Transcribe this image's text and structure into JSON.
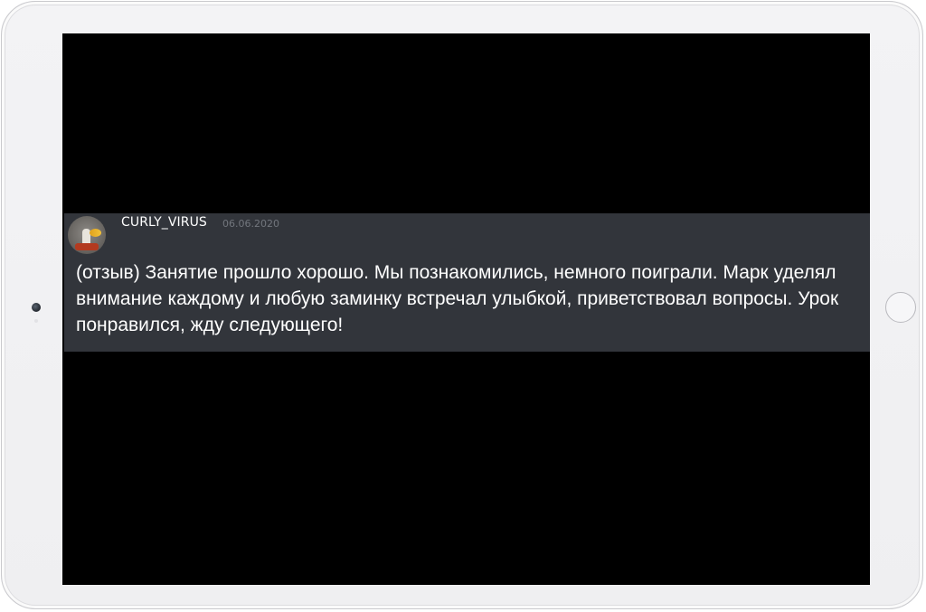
{
  "message": {
    "author": "CURLY_VIRUS",
    "date": "06.06.2020",
    "text": "(отзыв) Занятие прошло хорошо. Мы познакомились, немного поиграли. Марк уделял внимание каждому и любую заминку встречал улыбкой, приветствовал вопросы. Урок понравился, жду следующего!"
  },
  "colors": {
    "screen_background": "#000000",
    "message_background": "#32353b",
    "author_text": "#ffffff",
    "timestamp_text": "#72767d",
    "body_text": "#ffffff"
  },
  "icons": {
    "avatar": "user-avatar-image"
  }
}
